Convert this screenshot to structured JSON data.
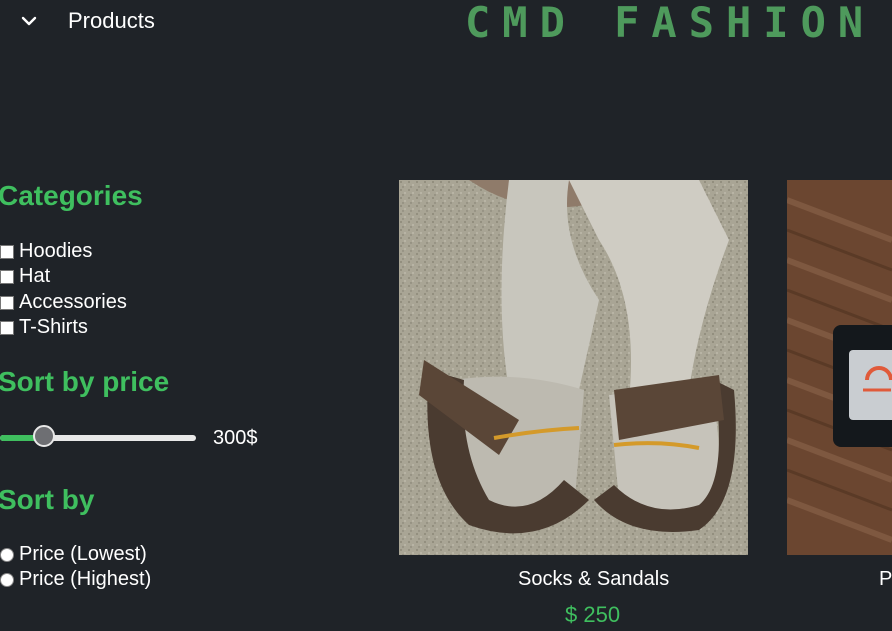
{
  "header": {
    "nav_label": "Products",
    "brand": "CMD FASHION"
  },
  "sidebar": {
    "categories_title": "Categories",
    "categories": [
      "Hoodies",
      "Hat",
      "Accessories",
      "T-Shirts"
    ],
    "price_title": "Sort by price",
    "price_value": "300$",
    "price_fraction": 0.19,
    "sort_title": "Sort by",
    "sort_options": [
      "Price (Lowest)",
      "Price (Highest)"
    ]
  },
  "products": [
    {
      "title": "Socks & Sandals",
      "price": "$ 250"
    },
    {
      "title": "P",
      "price": ""
    }
  ],
  "colors": {
    "background": "#1f2328",
    "accent": "#3fbf5f",
    "brand": "#4e9a5c"
  }
}
